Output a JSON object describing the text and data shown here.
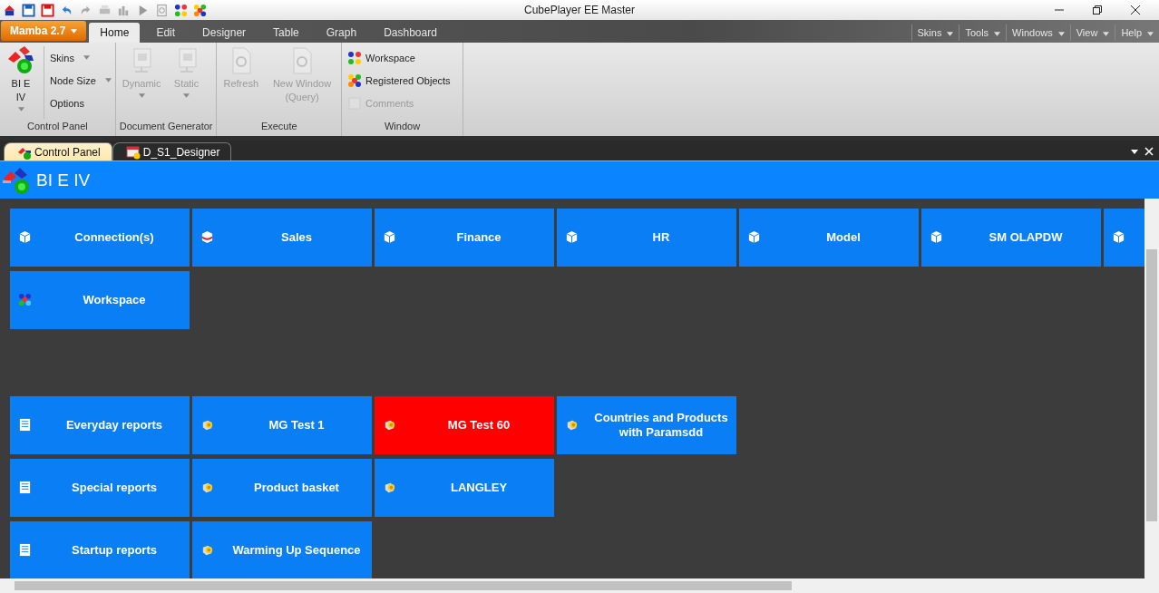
{
  "window": {
    "title": "CubePlayer EE Master"
  },
  "app_menu": {
    "label": "Mamba 2.7"
  },
  "ribbon_tabs": [
    {
      "label": "Home",
      "selected": true
    },
    {
      "label": "Edit",
      "selected": false
    },
    {
      "label": "Designer",
      "selected": false
    },
    {
      "label": "Table",
      "selected": false
    },
    {
      "label": "Graph",
      "selected": false
    },
    {
      "label": "Dashboard",
      "selected": false
    }
  ],
  "top_menu": [
    "Skins",
    "Tools",
    "Windows",
    "View",
    "Help"
  ],
  "ribbon_groups": [
    {
      "title": "Control Panel",
      "items": [
        {
          "kind": "large",
          "label": "BI E IV",
          "disabled": false,
          "dropdown": true
        },
        {
          "kind": "small",
          "label": "Skins",
          "disabled": false,
          "dropdown": true
        },
        {
          "kind": "small",
          "label": "Node Size",
          "disabled": false,
          "dropdown": true
        },
        {
          "kind": "small",
          "label": "Options",
          "disabled": false,
          "dropdown": false
        }
      ]
    },
    {
      "title": "Document Generator",
      "items": [
        {
          "kind": "large",
          "label": "Dynamic",
          "disabled": true,
          "dropdown": true
        },
        {
          "kind": "large",
          "label": "Static",
          "disabled": true,
          "dropdown": true
        }
      ]
    },
    {
      "title": "Execute",
      "items": [
        {
          "kind": "large",
          "label": "Refresh",
          "disabled": true,
          "dropdown": false
        },
        {
          "kind": "large",
          "label": "New Window (Query)",
          "disabled": true,
          "dropdown": false
        }
      ]
    },
    {
      "title": "Window",
      "items": [
        {
          "kind": "small",
          "label": "Workspace",
          "disabled": false,
          "dropdown": false
        },
        {
          "kind": "small",
          "label": "Registered Objects",
          "disabled": false,
          "dropdown": false
        },
        {
          "kind": "small",
          "label": "Comments",
          "disabled": true,
          "dropdown": false
        }
      ]
    }
  ],
  "doc_tabs": [
    {
      "label": "Control Panel",
      "selected": true
    },
    {
      "label": "D_S1_Designer",
      "selected": false
    }
  ],
  "panel_header": {
    "title": "BI E IV"
  },
  "cube_tiles": [
    {
      "label": "Connection(s)",
      "kind": "cube",
      "selected": false
    },
    {
      "label": "Sales",
      "kind": "sales",
      "selected": false
    },
    {
      "label": "Finance",
      "kind": "cube",
      "selected": false
    },
    {
      "label": "HR",
      "kind": "cube",
      "selected": false
    },
    {
      "label": "Model",
      "kind": "cube",
      "selected": false
    },
    {
      "label": "SM OLAPDW",
      "kind": "cube",
      "selected": false
    },
    {
      "kind": "cube",
      "selected": false
    },
    {
      "label": "Workspace",
      "kind": "workspace",
      "selected": false
    }
  ],
  "report_groups": [
    {
      "label": "Everyday reports",
      "items": [
        {
          "label": "MG Test 1",
          "selected": false
        },
        {
          "label": "MG Test 60",
          "selected": true
        },
        {
          "label": "Countries and Products with Paramsdd",
          "selected": false
        }
      ]
    },
    {
      "label": "Special reports",
      "items": [
        {
          "label": "Product basket",
          "selected": false
        },
        {
          "label": "LANGLEY",
          "selected": false
        }
      ]
    },
    {
      "label": "Startup reports",
      "items": [
        {
          "label": "Warming Up Sequence",
          "selected": false
        }
      ]
    }
  ]
}
